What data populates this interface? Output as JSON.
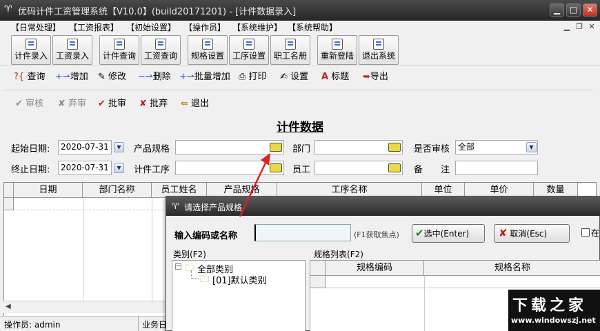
{
  "window": {
    "title": "优码计件工资管理系统【V10.0】(build20171201) - [计件数据录入]"
  },
  "menu": [
    "【日常处理】",
    "【工资报表】",
    "【初始设置】",
    "【操作员】",
    "【系统维护】",
    "【系统帮助】"
  ],
  "toolbar": [
    "计件录入",
    "工资录入",
    "计件查询",
    "工资查询",
    "规格设置",
    "工序设置",
    "职工名册",
    "重新登陆",
    "退出系统"
  ],
  "actions": [
    "查询",
    "增加",
    "修改",
    "删除",
    "批量增加",
    "打印",
    "设置",
    "标题",
    "导出"
  ],
  "approve": {
    "review": "审核",
    "abandon": "弃审",
    "batch_review": "批审",
    "batch_abandon": "批弃",
    "exit": "退出"
  },
  "form": {
    "title": "计件数据",
    "start_label": "起始日期:",
    "start_value": "2020-07-31",
    "end_label": "终止日期:",
    "end_value": "2020-07-31",
    "spec_label": "产品规格",
    "process_label": "计件工序",
    "dept_label": "部门",
    "emp_label": "员工",
    "audit_label": "是否审核",
    "audit_value": "全部",
    "note_label": "备　　注"
  },
  "grid": {
    "headers": [
      "日期",
      "部门名称",
      "员工姓名",
      "产品规格",
      "工序名称",
      "单位",
      "单价",
      "数量"
    ]
  },
  "status": {
    "operator": "操作员: admin",
    "business": "业务日"
  },
  "dialog": {
    "title": "请选择产品规格",
    "input_label": "输入编码或名称",
    "input_hint": "(F1获取焦点)",
    "ok_label": "选中(Enter)",
    "cancel_label": "取消(Esc)",
    "extra_label": "在",
    "category_label": "类别(F2)",
    "list_label": "规格列表(F2)",
    "tree_root": "全部类别",
    "tree_child": "[01]默认类别",
    "list_headers": [
      "规格编码",
      "规格名称"
    ]
  },
  "watermark": {
    "name": "下载之家",
    "url": "www.windowszj.net"
  },
  "colors": {
    "arrow": "#e02020",
    "titlebar": "#2e2e2e",
    "accent_ok": "#1a8a1a",
    "accent_cancel": "#c01818"
  }
}
